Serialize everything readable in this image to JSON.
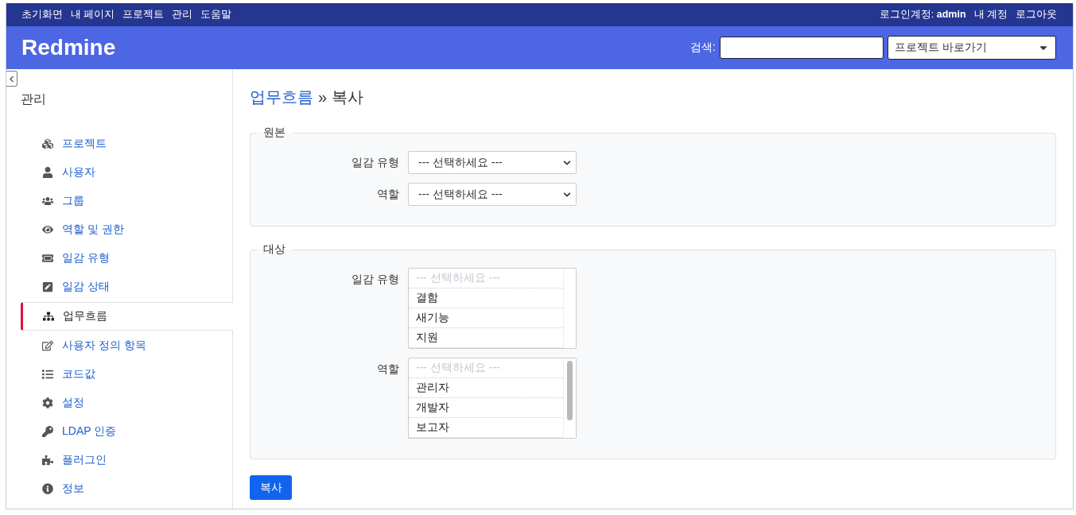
{
  "top_menu": [
    "초기화면",
    "내 페이지",
    "프로젝트",
    "관리",
    "도움말"
  ],
  "account": {
    "label": "로그인계정:",
    "user": "admin",
    "links": [
      "내 계정",
      "로그아웃"
    ]
  },
  "header": {
    "title": "Redmine",
    "search_label": "검색:",
    "project_jump": "프로젝트 바로가기"
  },
  "sidebar": {
    "title": "관리",
    "items": [
      {
        "label": "프로젝트",
        "selected": false
      },
      {
        "label": "사용자",
        "selected": false
      },
      {
        "label": "그룹",
        "selected": false
      },
      {
        "label": "역할 및 권한",
        "selected": false
      },
      {
        "label": "일감 유형",
        "selected": false
      },
      {
        "label": "일감 상태",
        "selected": false
      },
      {
        "label": "업무흐름",
        "selected": true
      },
      {
        "label": "사용자 정의 항목",
        "selected": false
      },
      {
        "label": "코드값",
        "selected": false
      },
      {
        "label": "설정",
        "selected": false
      },
      {
        "label": "LDAP 인증",
        "selected": false
      },
      {
        "label": "플러그인",
        "selected": false
      },
      {
        "label": "정보",
        "selected": false
      }
    ]
  },
  "content": {
    "breadcrumb_link": "업무흐름",
    "breadcrumb_rest": "» 복사",
    "sections": [
      {
        "legend": "원본",
        "fields": [
          {
            "label": "일감 유형",
            "kind": "dropdown",
            "value": "--- 선택하세요 ---"
          },
          {
            "label": "역할",
            "kind": "dropdown",
            "value": "--- 선택하세요 ---"
          }
        ]
      },
      {
        "legend": "대상",
        "fields": [
          {
            "label": "일감 유형",
            "kind": "listbox",
            "options": [
              {
                "text": "--- 선택하세요 ---",
                "disabled": true
              },
              {
                "text": "결함",
                "disabled": false
              },
              {
                "text": "새기능",
                "disabled": false
              },
              {
                "text": "지원",
                "disabled": false
              }
            ]
          },
          {
            "label": "역할",
            "kind": "listbox",
            "options": [
              {
                "text": "--- 선택하세요 ---",
                "disabled": true
              },
              {
                "text": "관리자",
                "disabled": false
              },
              {
                "text": "개발자",
                "disabled": false
              },
              {
                "text": "보고자",
                "disabled": false
              }
            ]
          }
        ]
      }
    ],
    "button": "복사"
  }
}
